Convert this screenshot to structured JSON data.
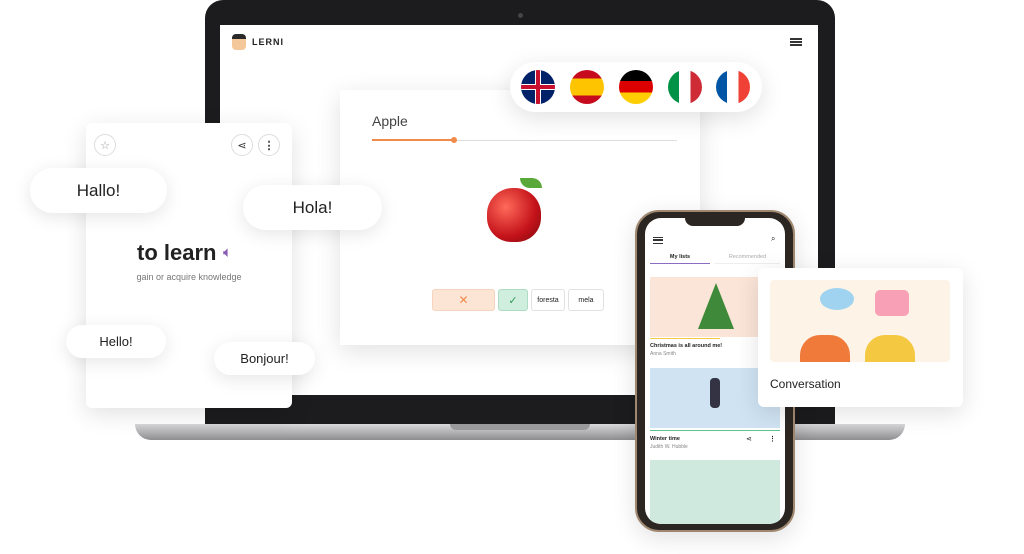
{
  "app": {
    "logo": "LERNI"
  },
  "flags": [
    {
      "name": "uk-flag"
    },
    {
      "name": "spain-flag"
    },
    {
      "name": "germany-flag"
    },
    {
      "name": "italy-flag"
    },
    {
      "name": "france-flag"
    }
  ],
  "quiz": {
    "word": "Apple",
    "progress": 0.27,
    "options": [
      "foresta",
      "mela"
    ],
    "accent": "#f08a4b"
  },
  "flashcard": {
    "word": "to learn",
    "definition": "gain or acquire knowledge"
  },
  "bubbles": [
    "Hallo!",
    "Hola!",
    "Hello!",
    "Bonjour!"
  ],
  "phone": {
    "tabs": [
      "My lists",
      "Recommended"
    ],
    "lists": [
      {
        "title": "Christmas is all around me!",
        "author": "Anna Smith"
      },
      {
        "title": "Winter time",
        "author": "Judith W. Hubble"
      }
    ]
  },
  "conversation": {
    "label": "Conversation"
  }
}
